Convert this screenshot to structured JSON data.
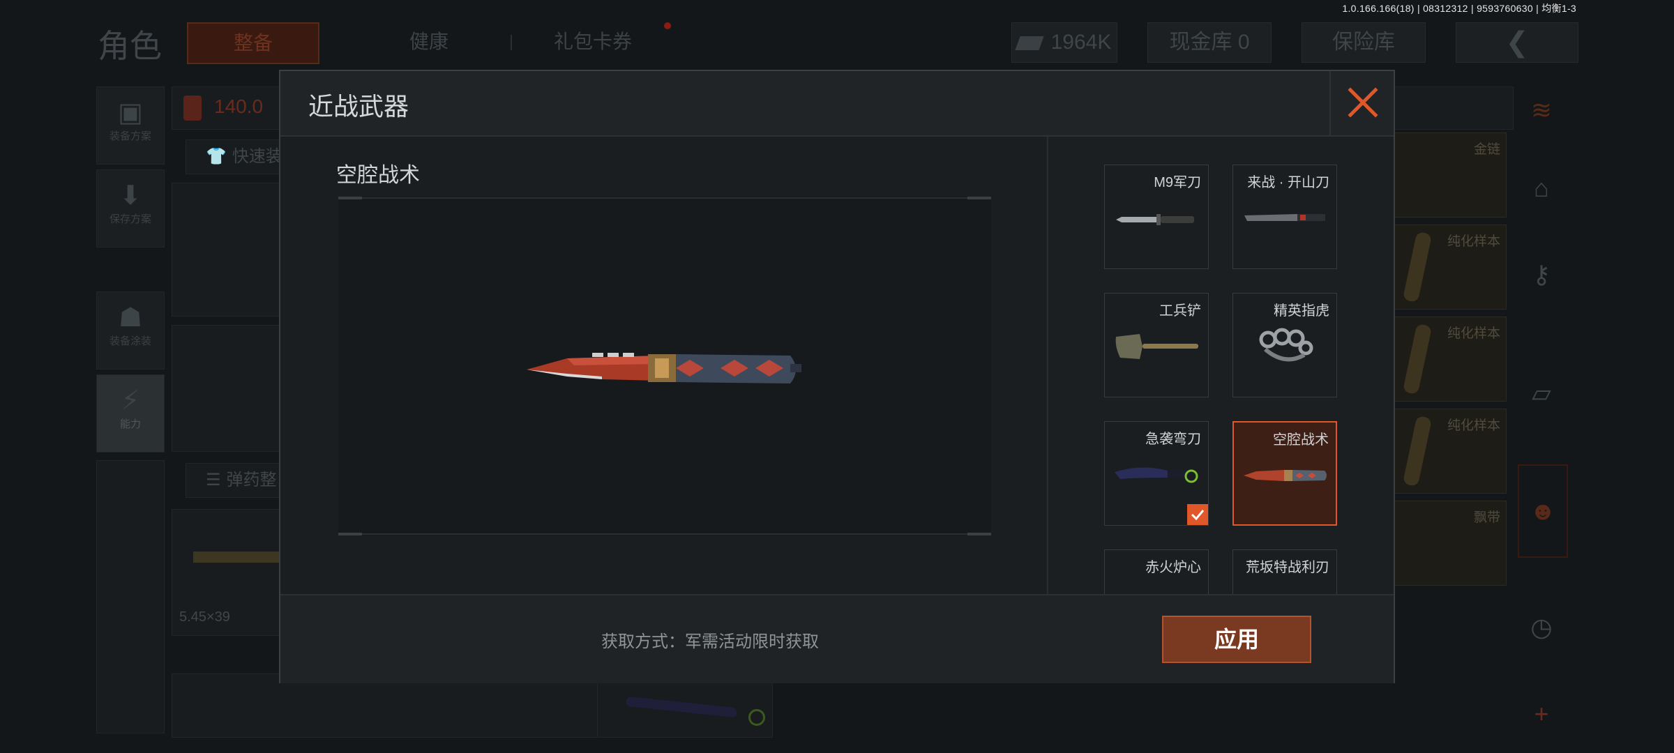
{
  "version_info": "1.0.166.166(18) | 08312312 | 9593760630 | 均衡1-3",
  "background": {
    "top_title": "角色",
    "tabs": [
      "整备",
      "健康",
      "礼包卡券"
    ],
    "currency": "1964K",
    "cash_vault": "现金库 0",
    "safe_box": "保险库",
    "left_menu": [
      "装备方案",
      "保存方案",
      "装备涂装",
      "能力"
    ],
    "weight": "140.0",
    "quick_equip": "快速装",
    "ammo_arrange": "弹药整",
    "ammo_caliber": "5.45×39",
    "right_slots": [
      "金链",
      "纯化样本",
      "纯化样本",
      "纯化样本",
      "飘带"
    ]
  },
  "dialog": {
    "title": "近战武器",
    "selected_item_name": "空腔战术",
    "acquire_method": "获取方式：军需活动限时获取",
    "apply_label": "应用",
    "skins": [
      {
        "name": "M9军刀",
        "icon": "bayonet-knife-icon",
        "selected": false,
        "equipped": false
      },
      {
        "name": "来战 · 开山刀",
        "icon": "machete-icon",
        "selected": false,
        "equipped": false
      },
      {
        "name": "工兵铲",
        "icon": "shovel-icon",
        "selected": false,
        "equipped": false
      },
      {
        "name": "精英指虎",
        "icon": "knuckles-icon",
        "selected": false,
        "equipped": false
      },
      {
        "name": "急袭弯刀",
        "icon": "curved-blade-icon",
        "selected": false,
        "equipped": true
      },
      {
        "name": "空腔战术",
        "icon": "tactical-knife-icon",
        "selected": true,
        "equipped": false
      },
      {
        "name": "赤火炉心",
        "icon": "blade-icon",
        "selected": false,
        "equipped": false
      },
      {
        "name": "荒坂特战利刃",
        "icon": "blade-icon",
        "selected": false,
        "equipped": false
      }
    ]
  },
  "colors": {
    "accent": "#e0572a",
    "apply_bg": "#7a3a22",
    "selected_card_bg": "#3e1f15"
  }
}
